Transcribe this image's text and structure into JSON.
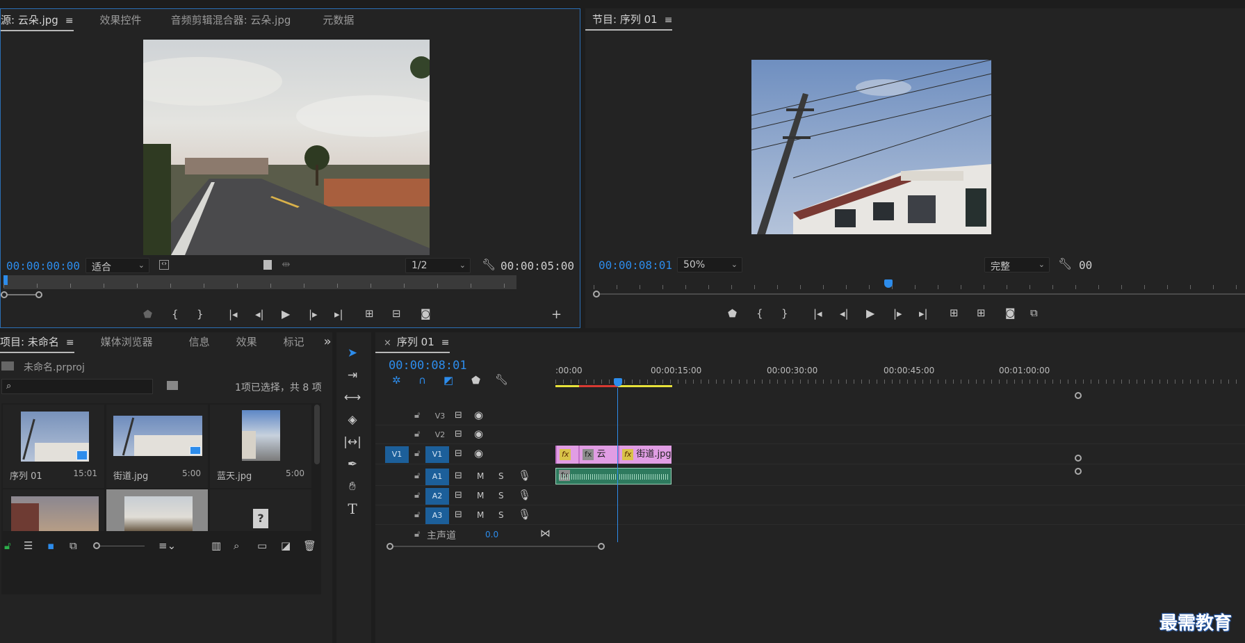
{
  "source_panel": {
    "tabs": [
      "源: 云朵.jpg",
      "效果控件",
      "音频剪辑混合器: 云朵.jpg",
      "元数据"
    ],
    "menu_glyph": "≡",
    "timecode_in": "00:00:00:00",
    "fit_dropdown": "适合",
    "resolution_dropdown": "1/2",
    "timecode_duration": "00:00:05:00"
  },
  "program_panel": {
    "title": "节目: 序列 01",
    "menu_glyph": "≡",
    "timecode": "00:00:08:01",
    "zoom_dropdown": "50%",
    "quality_dropdown": "完整",
    "timecode_right_partial": "00"
  },
  "project_panel": {
    "tabs": [
      "项目: 未命名",
      "媒体浏览器",
      "信息",
      "效果",
      "标记"
    ],
    "more_glyph": "»",
    "project_file": "未命名.prproj",
    "search_placeholder": "",
    "selection_status": "1项已选择，共 8 项",
    "items": [
      {
        "name": "序列 01",
        "duration": "15:01"
      },
      {
        "name": "街道.jpg",
        "duration": "5:00"
      },
      {
        "name": "蓝天.jpg",
        "duration": "5:00"
      },
      {
        "name": "",
        "duration": ""
      },
      {
        "name": "",
        "duration": ""
      },
      {
        "name": "",
        "duration": ""
      }
    ]
  },
  "timeline": {
    "sequence_tab": "序列 01",
    "close_glyph": "×",
    "timecode": "00:00:08:01",
    "ruler_labels": [
      ":00:00",
      "00:00:15:00",
      "00:00:30:00",
      "00:00:45:00",
      "00:01:00:00"
    ],
    "video_tracks": [
      {
        "name": "V3",
        "source": ""
      },
      {
        "name": "V2",
        "source": ""
      },
      {
        "name": "V1",
        "source": "V1"
      }
    ],
    "audio_tracks": [
      {
        "name": "A1",
        "m": "M",
        "s": "S"
      },
      {
        "name": "A2",
        "m": "M",
        "s": "S"
      },
      {
        "name": "A3",
        "m": "M",
        "s": "S"
      }
    ],
    "master": {
      "label": "主声道",
      "value": "0.0"
    },
    "clips": [
      {
        "fx": "fx",
        "label": ""
      },
      {
        "fx": "fx",
        "label": "云"
      },
      {
        "fx": "fx",
        "label": "街道.jpg"
      }
    ]
  },
  "watermark": "最需教育",
  "colors": {
    "accent_blue": "#2d8ceb",
    "clip_pink": "#e19de4",
    "audio_green": "#2e7a5e",
    "track_blue": "#1c5f9a"
  }
}
